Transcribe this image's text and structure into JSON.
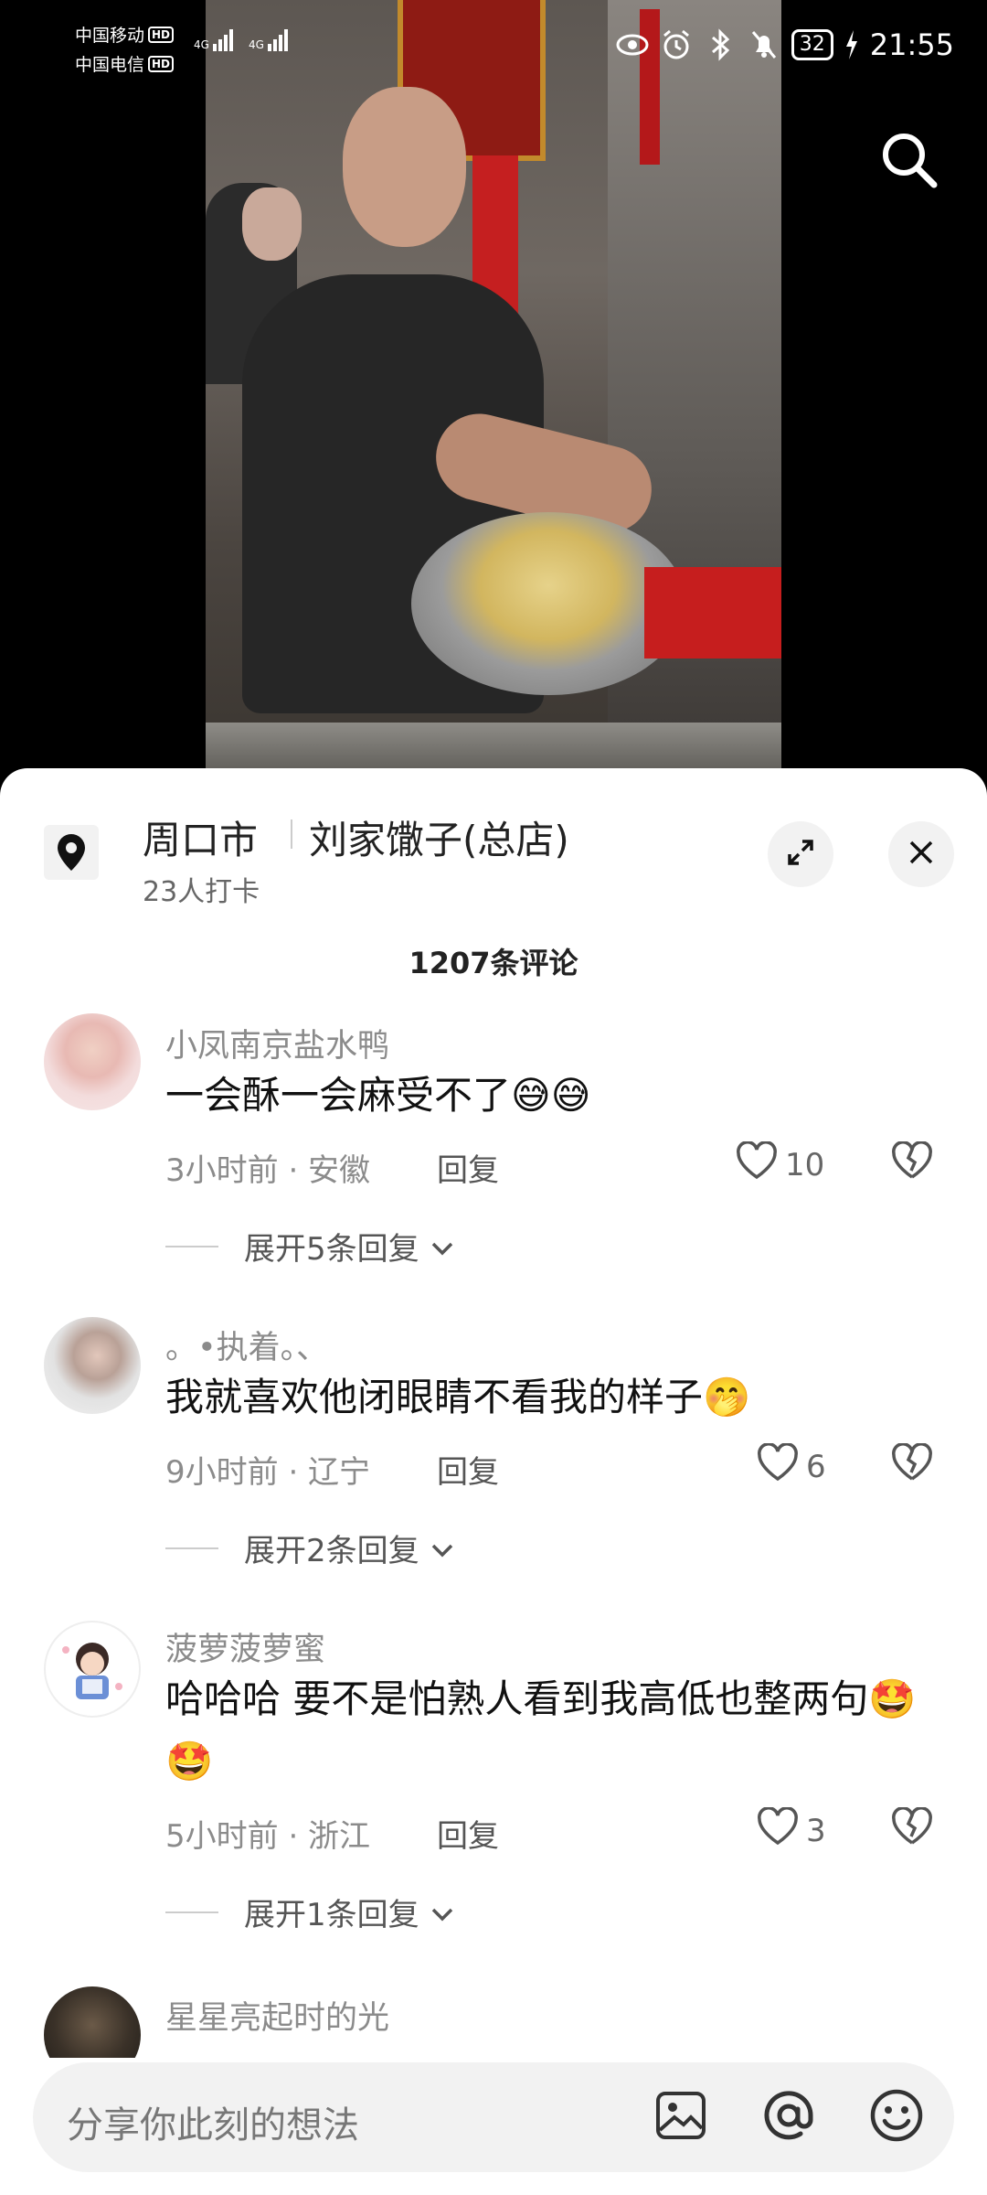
{
  "status_bar": {
    "carrier1": "中国移动",
    "carrier2": "中国电信",
    "hd": "HD",
    "net_type": "4G",
    "battery": "32",
    "time": "21:55"
  },
  "location": {
    "city": "周口市",
    "shop": "刘家馓子(总店)",
    "checkins": "23人打卡"
  },
  "comment_count": "1207条评论",
  "comments": [
    {
      "user": "小凤南京盐水鸭",
      "text": "一会酥一会麻受不了😅😅",
      "time_place": "3小时前 · 安徽",
      "reply": "回复",
      "likes": "10",
      "expand": "展开5条回复"
    },
    {
      "user": "。•执着。、",
      "text": "我就喜欢他闭眼睛不看我的样子🤭",
      "time_place": "9小时前 · 辽宁",
      "reply": "回复",
      "likes": "6",
      "expand": "展开2条回复"
    },
    {
      "user": "菠萝菠萝蜜",
      "text": "哈哈哈 要不是怕熟人看到我高低也整两句🤩🤩",
      "time_place": "5小时前 · 浙江",
      "reply": "回复",
      "likes": "3",
      "expand": "展开1条回复"
    },
    {
      "user": "星星亮起时的光"
    }
  ],
  "input": {
    "placeholder": "分享你此刻的想法"
  },
  "icons": {
    "search": "search-icon",
    "location": "location-pin-icon",
    "expand": "expand-icon",
    "close": "close-icon",
    "like": "heart-icon",
    "dislike": "broken-heart-icon",
    "image": "image-icon",
    "at": "at-icon",
    "emoji": "emoji-icon"
  }
}
